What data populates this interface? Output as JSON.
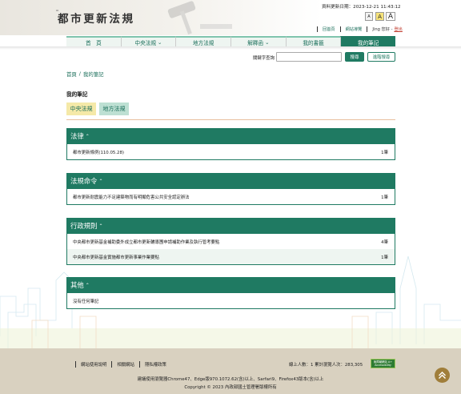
{
  "header": {
    "site_title": "都市更新法規",
    "update_label": "資料更新日期：2023-12-21 11:43:12",
    "font_sizes": [
      "A",
      "A",
      "A"
    ],
    "links": [
      "回首頁",
      "網站導覽"
    ],
    "user_greeting": "Jing 您好 - ",
    "logout": "登出"
  },
  "nav": {
    "items": [
      "首　頁",
      "中央法規",
      "地方法規",
      "解釋函",
      "我的書籤",
      "我的筆記"
    ],
    "active_index": 5
  },
  "search": {
    "label": "關鍵字查詢",
    "placeholder": "",
    "button": "搜尋",
    "advanced": "進階搜尋"
  },
  "breadcrumb": [
    "首頁",
    "/",
    "我的筆記"
  ],
  "page_title": "我的筆記",
  "tabs": [
    "中央法規",
    "地方法規"
  ],
  "sections": [
    {
      "title": "法律",
      "rows": [
        {
          "name": "都市更新條例(110.05.28)",
          "count": "1筆"
        }
      ]
    },
    {
      "title": "法規命令",
      "rows": [
        {
          "name": "都市更新耐震能力不足建築物而有明顯危害公共安全認定辦法",
          "count": "1筆"
        }
      ]
    },
    {
      "title": "行政規則",
      "rows": [
        {
          "name": "中央都市更新基金補助委外成立都市更新輔導團申請補助作業及執行管考要點",
          "count": "4筆"
        },
        {
          "name": "中央都市更新基金實施都市更新事業作業要點",
          "count": "1筆"
        }
      ]
    },
    {
      "title": "其他",
      "rows": [
        {
          "name": "沒有任何筆記",
          "count": ""
        }
      ]
    }
  ],
  "footer": {
    "links": [
      "網站使用說明",
      "相關網站",
      "隱私權政策"
    ],
    "visitors": "線上人數：1 累計瀏覽人次：283,305",
    "badge": "無障礙網站 A+ Accessibility",
    "browser_note": "建議使用瀏覽器Chrome47、Edge版970.1072.62(含)以上、Sarfari9、Firefox43版本(含)以上",
    "copyright": "Copyright © 2023 內政部國土管理署版權所有"
  },
  "colors": {
    "primary": "#1f7a62",
    "accent_yellow": "#f5e9a8",
    "footer_bg": "#d9d1c0"
  }
}
